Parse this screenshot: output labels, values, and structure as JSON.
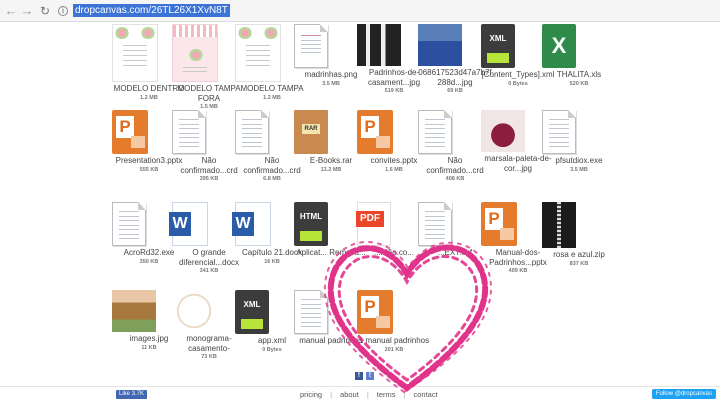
{
  "browser": {
    "url": "dropcanvas.com/26TL26X1XvN8T",
    "back_glyph": "←",
    "forward_glyph": "→",
    "reload_glyph": "↻",
    "info_glyph": "i"
  },
  "files": [
    {
      "name": "MODELO DENTRO",
      "size": "1.2 MB",
      "icon": "card-white"
    },
    {
      "name": "MODELO TAMPA FORA",
      "size": "1.5 MB",
      "icon": "card-pink"
    },
    {
      "name": "MODELO TAMPA",
      "size": "1.2 MB",
      "icon": "card-white"
    },
    {
      "name": "madrinhas.png",
      "size": "3.5 MB",
      "icon": "image-doc"
    },
    {
      "name": "Padrinhos-de-casament...jpg",
      "size": "519 KB",
      "icon": "image-photo-people"
    },
    {
      "name": "068617523d47a7b7f288d...jpg",
      "size": "69 KB",
      "icon": "image-photo-group"
    },
    {
      "name": "[Content_Types].xml",
      "size": "0 Bytes",
      "icon": "xml"
    },
    {
      "name": "THALITA.xls",
      "size": "520 KB",
      "icon": "xls"
    },
    {
      "name": "Presentation3.pptx",
      "size": "555 KB",
      "icon": "ppt"
    },
    {
      "name": "Não confirmado...crd",
      "size": "395 KB",
      "icon": "doc"
    },
    {
      "name": "Não confirmado...crd",
      "size": "6.8 MB",
      "icon": "doc"
    },
    {
      "name": "E-Books.rar",
      "size": "13.2 MB",
      "icon": "rar"
    },
    {
      "name": "convites.pptx",
      "size": "1.6 MB",
      "icon": "ppt"
    },
    {
      "name": "Não confirmado...crd",
      "size": "408 KB",
      "icon": "doc"
    },
    {
      "name": "marsala-paleta-de-cor...jpg",
      "size": "",
      "icon": "image-photo-marsala"
    },
    {
      "name": "pfsutdiox.exe",
      "size": "3.5 MB",
      "icon": "doc"
    },
    {
      "name": "AcroRd32.exe",
      "size": "350 KB",
      "icon": "doc"
    },
    {
      "name": "O grande diferencial...docx",
      "size": "341 KB",
      "icon": "word"
    },
    {
      "name": "Capítulo 21.docx",
      "size": "16 KB",
      "icon": "word"
    },
    {
      "name": "Aplicat... Remova...",
      "size": "",
      "icon": "html"
    },
    {
      "name": "...rdão.co...",
      "size": "",
      "icon": "pdf"
    },
    {
      "name": "...EXT.ecf",
      "size": "",
      "icon": "doc"
    },
    {
      "name": "Manual-dos-Padrinhos...pptx",
      "size": "409 KB",
      "icon": "ppt"
    },
    {
      "name": "rosa e azul.zip",
      "size": "837 KB",
      "icon": "zip"
    },
    {
      "name": "images.jpg",
      "size": "11 KB",
      "icon": "image-photo-garden"
    },
    {
      "name": "monograma-casamento-",
      "size": "73 KB",
      "icon": "image-monogram"
    },
    {
      "name": "app.xml",
      "size": "0 Bytes",
      "icon": "xml"
    },
    {
      "name": "manual padrinhos",
      "size": "",
      "icon": "doc"
    },
    {
      "name": "1 manual padrinhos",
      "size": "201 KB",
      "icon": "ppt"
    }
  ],
  "icon_text": {
    "xml": "XML",
    "html": "HTML",
    "pdf": "PDF",
    "rar": "RAR",
    "ppt": "P",
    "word": "W",
    "xls": "X"
  },
  "footer": {
    "like": "Like 3.7K",
    "links": [
      "pricing",
      "about",
      "terms",
      "contact"
    ],
    "separator": "|",
    "twitter": "Follow @dropcanvas",
    "facebook_glyph": "f",
    "twitter_glyph": "t"
  },
  "colors": {
    "heart": "#e0338a",
    "ppt_orange": "#e47b2d",
    "word_blue": "#2a5ca8",
    "excel_green": "#2e8b49",
    "pdf_red": "#e9462a",
    "url_highlight": "#3b74d6"
  }
}
